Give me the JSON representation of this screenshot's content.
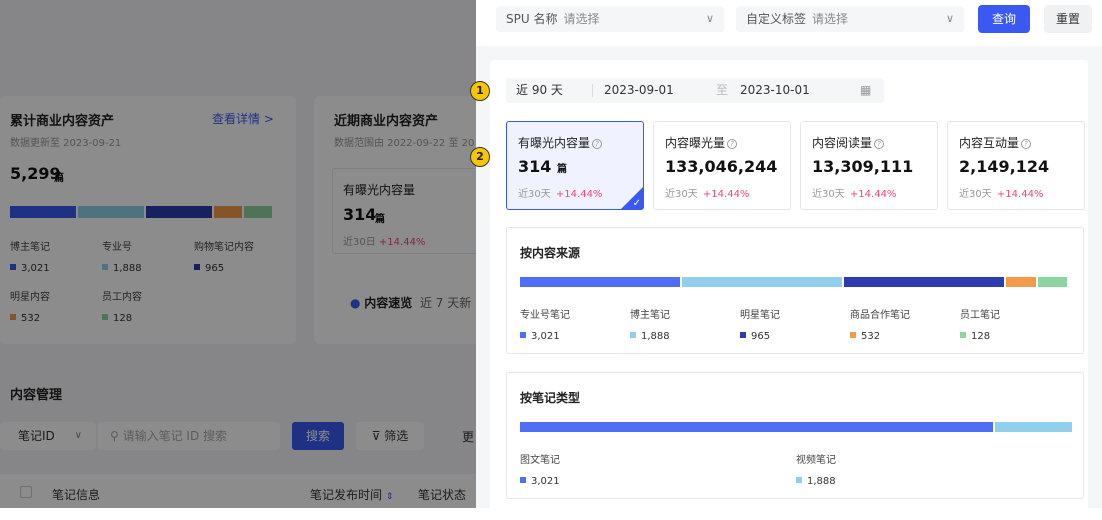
{
  "background": {
    "card1": {
      "title": "累计商业内容资产",
      "link": "查看详情 >",
      "sub": "数据更新至 2023-09-21",
      "total": "5,299",
      "unit": "篇",
      "legend": [
        {
          "label": "博主笔记",
          "value": "3,021",
          "color": "#3a59f2"
        },
        {
          "label": "专业号",
          "value": "1,888",
          "color": "#91d0ec"
        },
        {
          "label": "购物笔记内容",
          "value": "965",
          "color": "#2b3db0"
        },
        {
          "label": "明星内容",
          "value": "532",
          "color": "#f29a4a"
        },
        {
          "label": "员工内容",
          "value": "128",
          "color": "#8ed4a0"
        }
      ]
    },
    "card2": {
      "title": "近期商业内容资产",
      "sub": "数据范围由 2022-09-22 至 20",
      "inner_title": "有曝光内容量",
      "inner_value": "314",
      "inner_unit": "篇",
      "inner_change_label": "近30日",
      "inner_change": "+14.44%",
      "speed_label": "内容速览",
      "speed_note": "近 7 天新"
    },
    "manage": {
      "title": "内容管理",
      "id_select": "笔记ID",
      "search_placeholder": "请输入笔记 ID 搜索",
      "search_btn": "搜索",
      "filter_btn": "筛选",
      "more": "更",
      "col_info": "笔记信息",
      "col_time": "笔记发布时间",
      "col_status": "笔记状态"
    }
  },
  "drawer": {
    "filters": {
      "spu_label": "SPU 名称",
      "spu_placeholder": "请选择",
      "tag_label": "自定义标签",
      "tag_placeholder": "请选择",
      "query_btn": "查询",
      "reset_btn": "重置"
    },
    "markers": [
      "1",
      "2"
    ],
    "date": {
      "range": "近 90 天",
      "start": "2023-09-01",
      "sep": "至",
      "end": "2023-10-01"
    },
    "metrics": [
      {
        "title": "有曝光内容量",
        "value": "314",
        "unit": "篇",
        "change_label": "近30天",
        "change": "+14.44%",
        "active": true
      },
      {
        "title": "内容曝光量",
        "value": "133,046,244",
        "unit": "",
        "change_label": "近30天",
        "change": "+14.44%",
        "active": false
      },
      {
        "title": "内容阅读量",
        "value": "13,309,111",
        "unit": "",
        "change_label": "近30天",
        "change": "+14.44%",
        "active": false
      },
      {
        "title": "内容互动量",
        "value": "2,149,124",
        "unit": "",
        "change_label": "近30天",
        "change": "+14.44%",
        "active": false
      }
    ],
    "by_source": {
      "title": "按内容来源",
      "items": [
        {
          "label": "专业号笔记",
          "value": "3,021",
          "share": 0.294,
          "color": "#4d6ef5"
        },
        {
          "label": "博主笔记",
          "value": "1,888",
          "share": 0.294,
          "color": "#91d0ec"
        },
        {
          "label": "明星笔记",
          "value": "965",
          "share": 0.294,
          "color": "#2b3db0"
        },
        {
          "label": "商品合作笔记",
          "value": "532",
          "share": 0.055,
          "color": "#f29a4a"
        },
        {
          "label": "员工笔记",
          "value": "128",
          "share": 0.053,
          "color": "#8ed4a0"
        }
      ]
    },
    "by_type": {
      "title": "按笔记类型",
      "items": [
        {
          "label": "图文笔记",
          "value": "3,021",
          "share": 0.86,
          "color": "#4d6ef5"
        },
        {
          "label": "视频笔记",
          "value": "1,888",
          "share": 0.14,
          "color": "#91d0ec"
        }
      ]
    }
  }
}
